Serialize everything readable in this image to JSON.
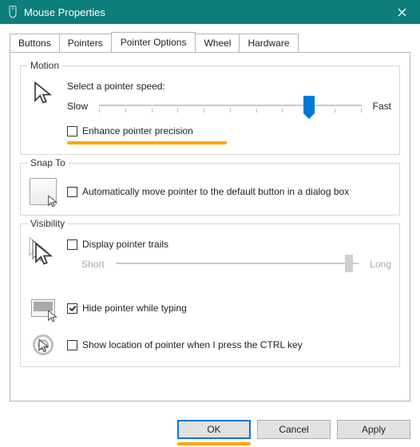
{
  "window": {
    "title": "Mouse Properties"
  },
  "tabs": {
    "buttons": "Buttons",
    "pointers": "Pointers",
    "pointer_options": "Pointer Options",
    "wheel": "Wheel",
    "hardware": "Hardware"
  },
  "motion": {
    "group": "Motion",
    "select_label": "Select a pointer speed:",
    "slow": "Slow",
    "fast": "Fast",
    "enhance": "Enhance pointer precision"
  },
  "snap": {
    "group": "Snap To",
    "auto": "Automatically move pointer to the default button in a dialog box"
  },
  "visibility": {
    "group": "Visibility",
    "trails": "Display pointer trails",
    "short": "Short",
    "long": "Long",
    "hide_typing": "Hide pointer while typing",
    "ctrl_show": "Show location of pointer when I press the CTRL key"
  },
  "buttons_bar": {
    "ok": "OK",
    "cancel": "Cancel",
    "apply": "Apply"
  }
}
